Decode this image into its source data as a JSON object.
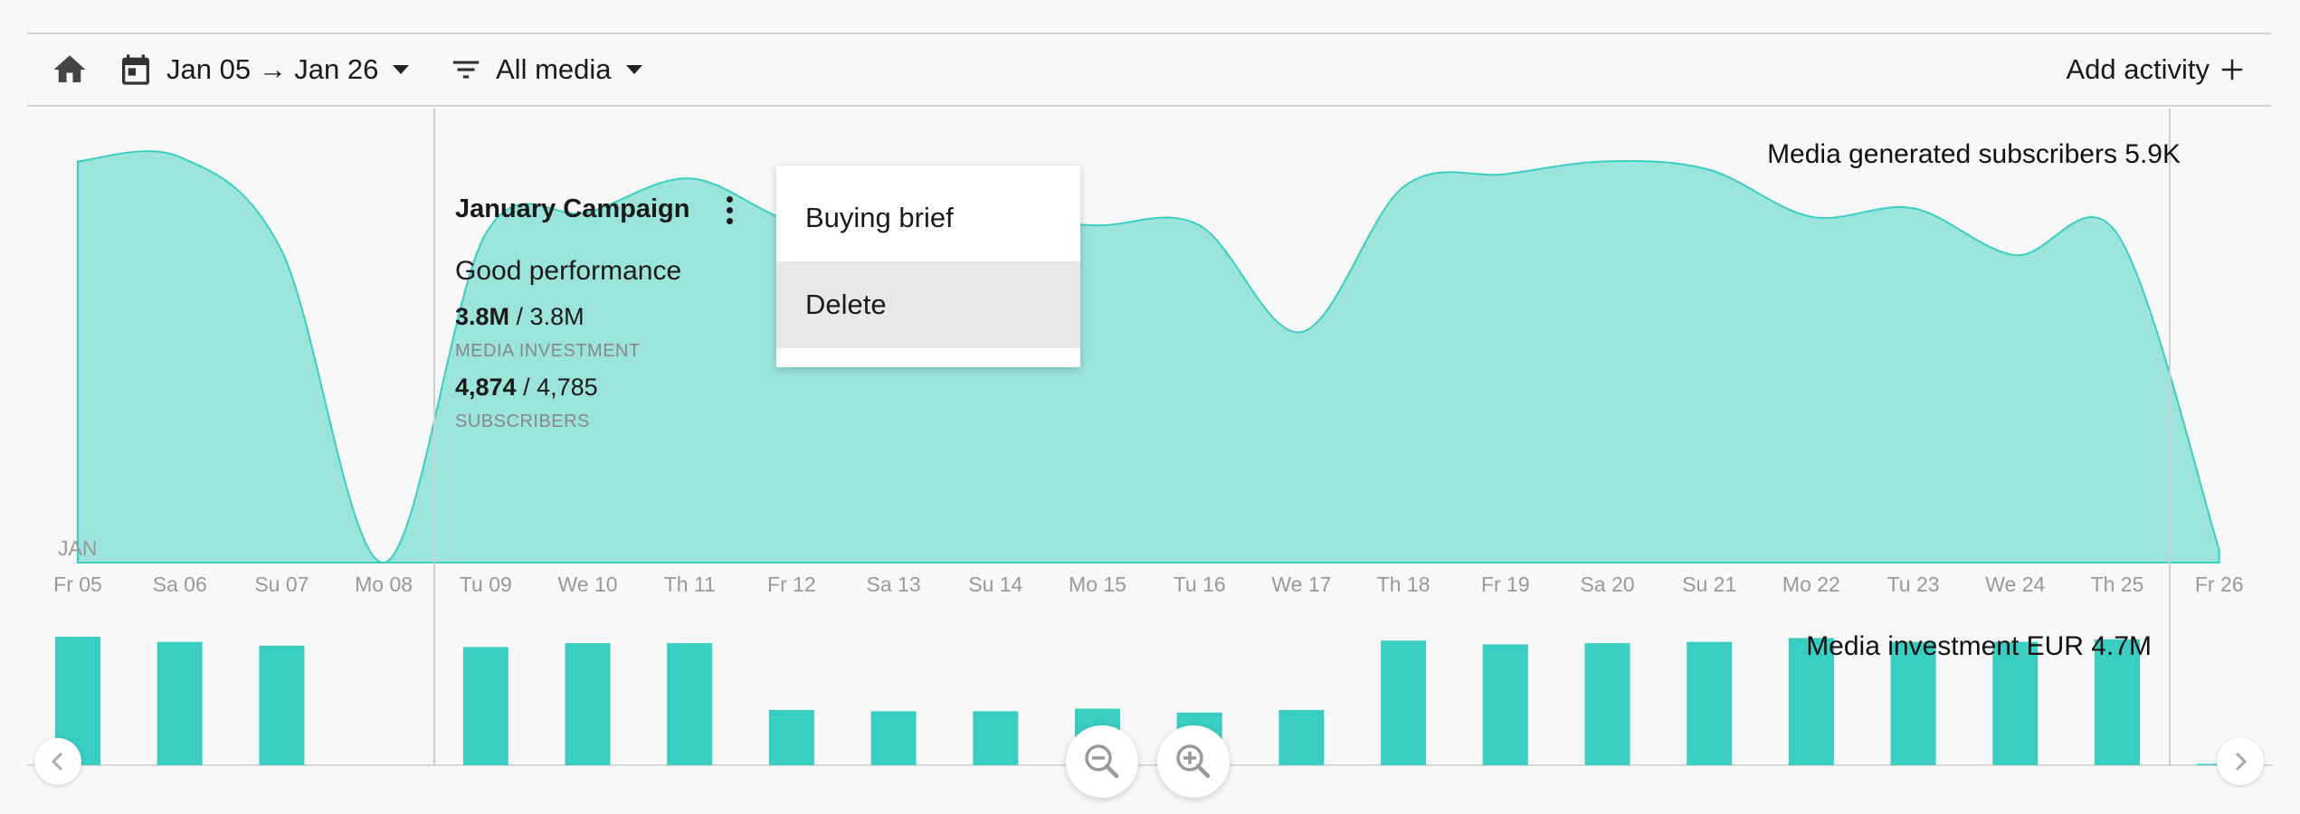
{
  "toolbar": {
    "home_icon": "home-icon",
    "calendar_icon": "calendar-icon",
    "date_range": "Jan 05 → Jan 26",
    "filter_icon": "filter-icon",
    "media_filter": "All media",
    "add_activity": "Add activity"
  },
  "chart": {
    "month_label": "JAN",
    "days": [
      "Fr 05",
      "Sa 06",
      "Su 07",
      "Mo 08",
      "Tu 09",
      "We 10",
      "Th 11",
      "Fr 12",
      "Sa 13",
      "Su 14",
      "Mo 15",
      "Tu 16",
      "We 17",
      "Th 18",
      "Fr 19",
      "Sa 20",
      "Su 21",
      "Mo 22",
      "Tu 23",
      "We 24",
      "Th 25",
      "Fr 26"
    ],
    "subscribers_label": "Media generated subscribers 5.9K",
    "investment_label": "Media investment EUR 4.7M",
    "colors": {
      "area_fill": "#9ae4dc",
      "area_stroke": "#3ccfc1",
      "bar": "#3acdc1",
      "axis_text": "#999999"
    }
  },
  "chart_data": [
    {
      "type": "area",
      "title": "Media generated subscribers 5.9K",
      "categories": [
        "Fr 05",
        "Sa 06",
        "Su 07",
        "Mo 08",
        "Tu 09",
        "We 10",
        "Th 11",
        "Fr 12",
        "Sa 13",
        "Su 14",
        "Mo 15",
        "Tu 16",
        "We 17",
        "Th 18",
        "Fr 19",
        "Sa 20",
        "Su 21",
        "Mo 22",
        "Tu 23",
        "We 24",
        "Th 25",
        "Fr 26"
      ],
      "values": [
        0.94,
        0.95,
        0.73,
        0.0,
        0.77,
        0.82,
        0.9,
        0.8,
        0.79,
        0.8,
        0.79,
        0.79,
        0.54,
        0.88,
        0.91,
        0.94,
        0.92,
        0.81,
        0.83,
        0.72,
        0.77,
        0.03
      ],
      "ylim": [
        0,
        1
      ],
      "grid": false
    },
    {
      "type": "bar",
      "title": "Media investment EUR 4.7M",
      "categories": [
        "Fr 05",
        "Sa 06",
        "Su 07",
        "Mo 08",
        "Tu 09",
        "We 10",
        "Th 11",
        "Fr 12",
        "Sa 13",
        "Su 14",
        "Mo 15",
        "Tu 16",
        "We 17",
        "Th 18",
        "Fr 19",
        "Sa 20",
        "Su 21",
        "Mo 22",
        "Tu 23",
        "We 24",
        "Th 25",
        "Fr 26"
      ],
      "values": [
        1.0,
        0.96,
        0.93,
        0,
        0.92,
        0.95,
        0.95,
        0.43,
        0.42,
        0.42,
        0.44,
        0.41,
        0.43,
        0.97,
        0.94,
        0.95,
        0.96,
        0.99,
        0.96,
        0.96,
        0.98,
        0.01
      ],
      "ylim": [
        0,
        1
      ],
      "grid": false
    }
  ],
  "campaign": {
    "title": "January Campaign",
    "status": "Good performance",
    "investment_actual": "3.8M",
    "investment_target": "/ 3.8M",
    "investment_label": "MEDIA INVESTMENT",
    "subscribers_actual": "4,874",
    "subscribers_target": "/ 4,785",
    "subscribers_label": "SUBSCRIBERS"
  },
  "context_menu": {
    "items": [
      {
        "label": "Buying brief"
      },
      {
        "label": "Delete"
      }
    ]
  },
  "controls": {
    "zoom_out_icon": "zoom-out-icon",
    "zoom_in_icon": "zoom-in-icon",
    "prev_icon": "chevron-left-icon",
    "next_icon": "chevron-right-icon"
  }
}
